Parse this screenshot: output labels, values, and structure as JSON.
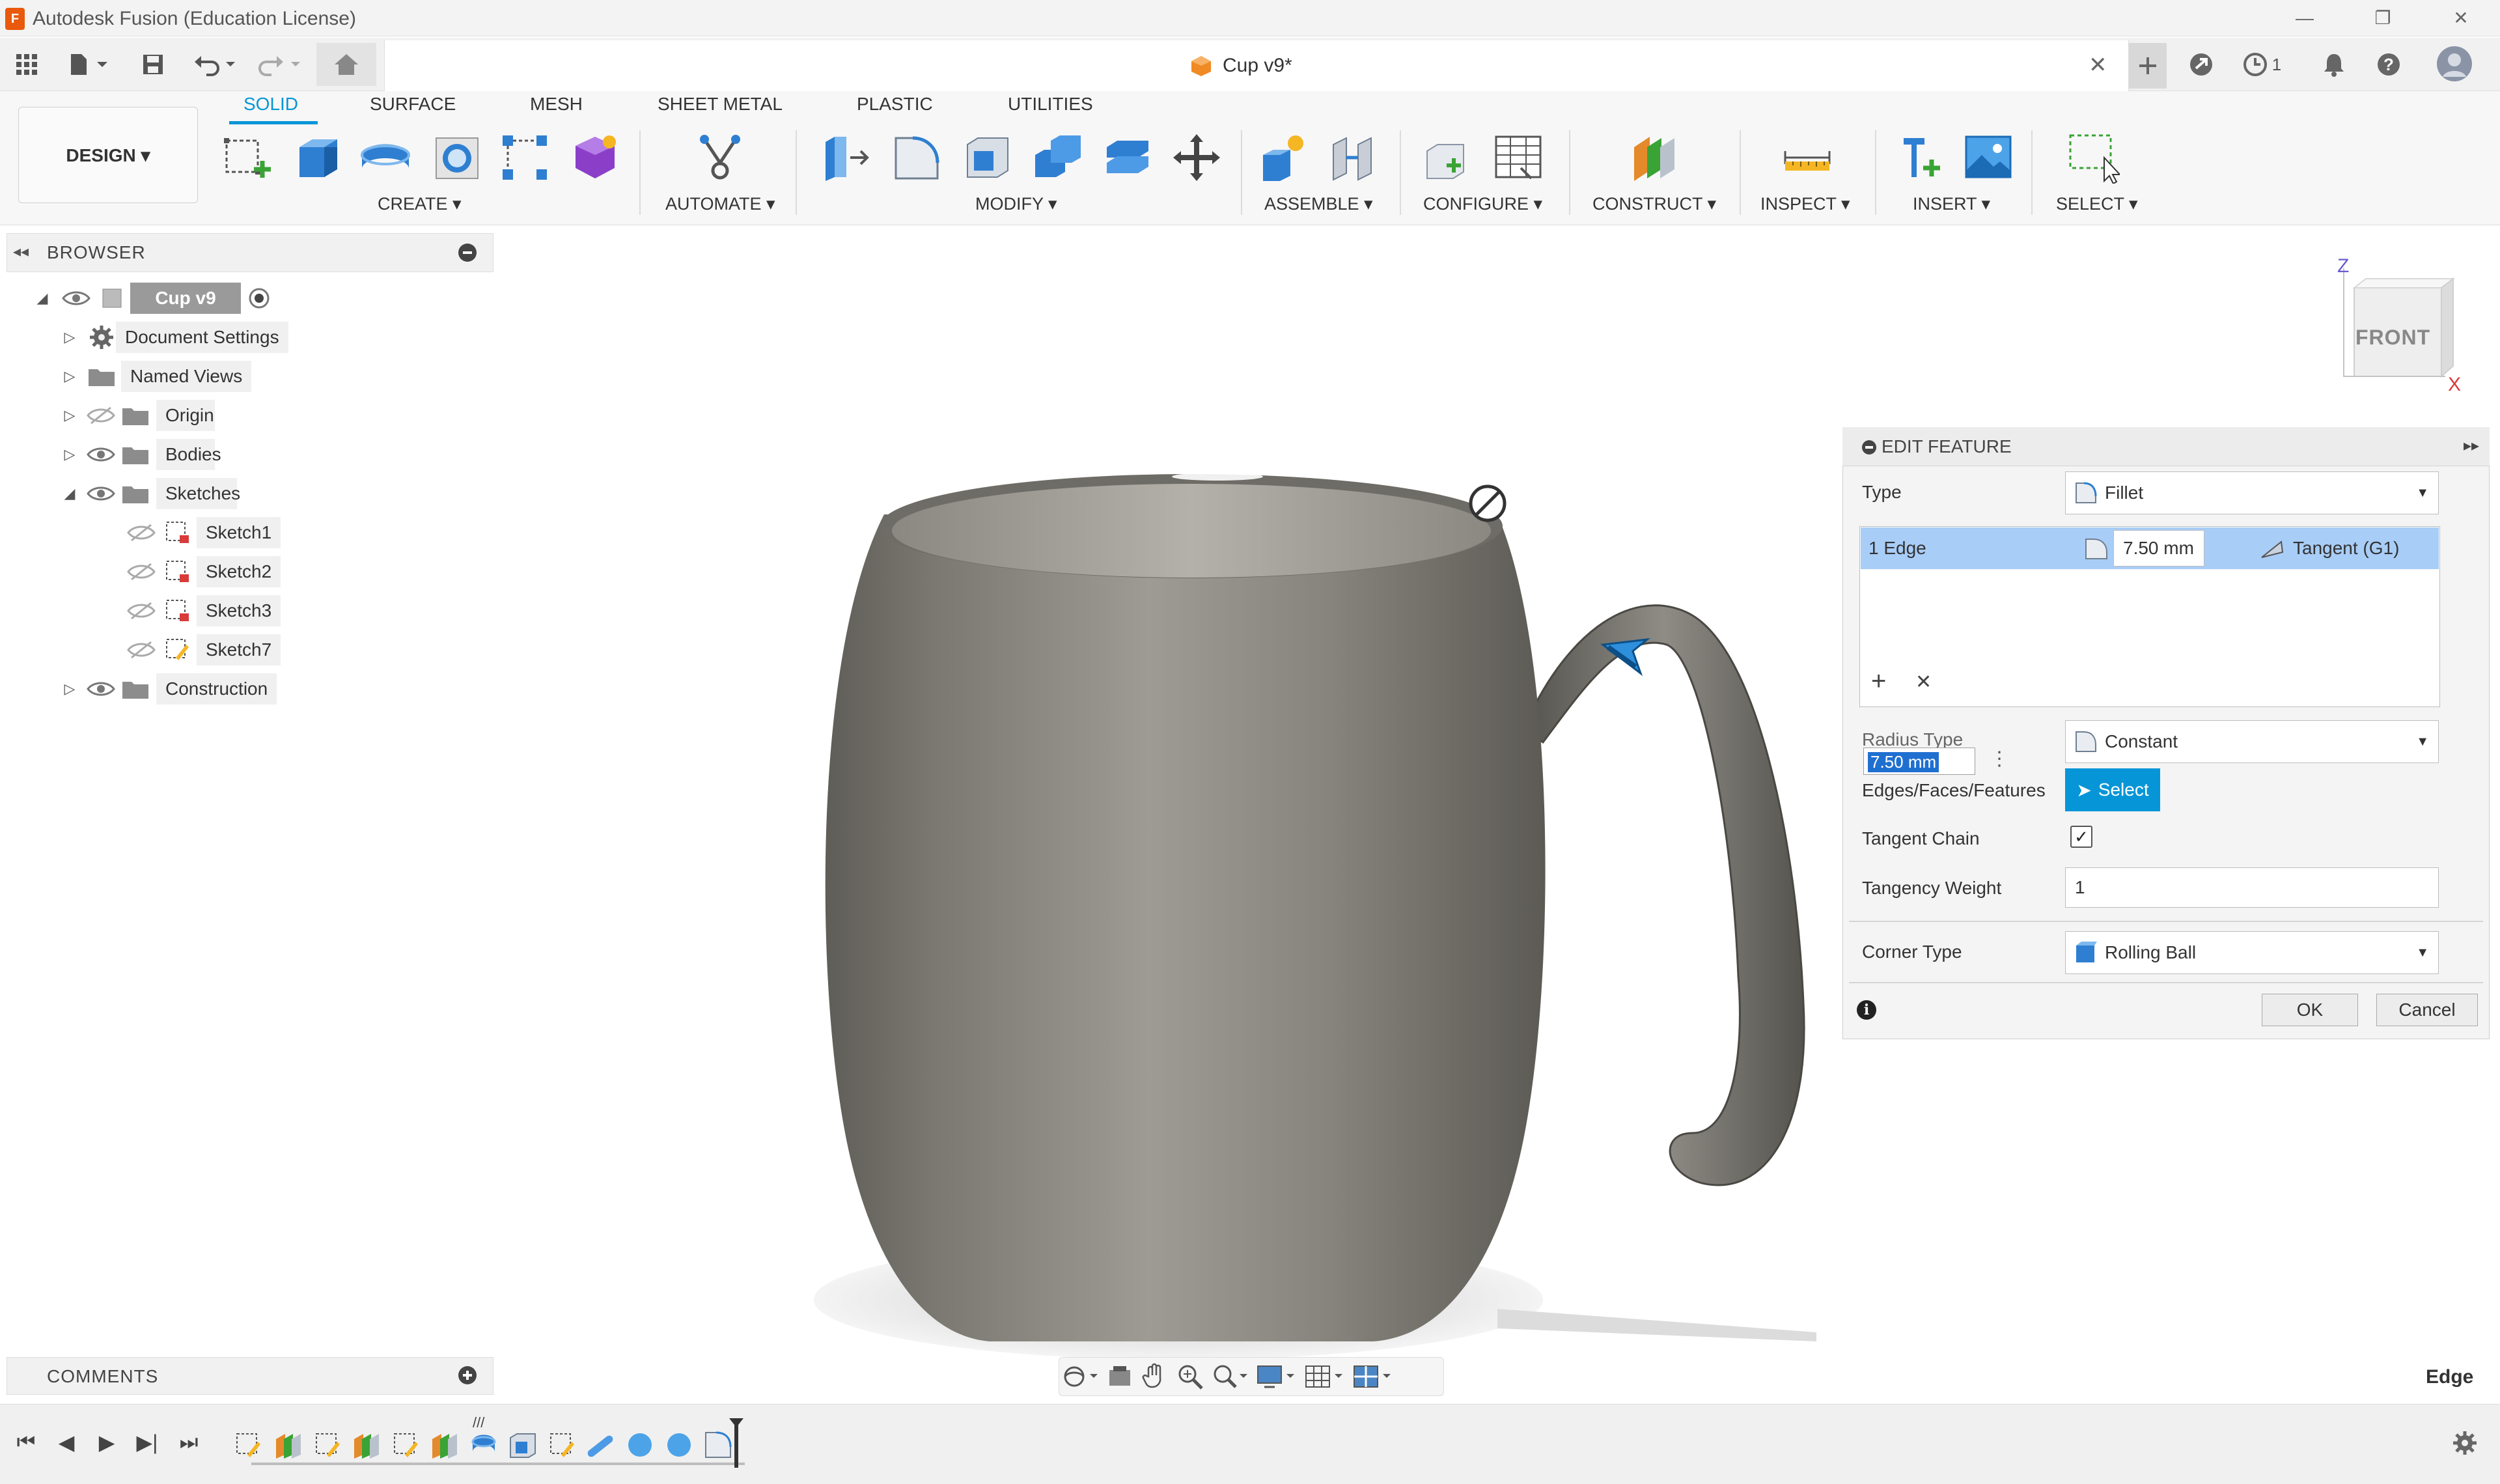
{
  "window": {
    "title": "Autodesk Fusion (Education License)",
    "logo_letter": "F",
    "minimize": "—",
    "restore": "❐",
    "close": "✕"
  },
  "doc_tab": {
    "label": "Cup v9*",
    "close": "✕",
    "notifications_count": "1"
  },
  "ribbon": {
    "workspace": "DESIGN ▾",
    "tabs": [
      "SOLID",
      "SURFACE",
      "MESH",
      "SHEET METAL",
      "PLASTIC",
      "UTILITIES"
    ],
    "active_tab": "SOLID",
    "groups": {
      "create": "CREATE ▾",
      "automate": "AUTOMATE ▾",
      "modify": "MODIFY ▾",
      "assemble": "ASSEMBLE ▾",
      "configure": "CONFIGURE ▾",
      "construct": "CONSTRUCT ▾",
      "inspect": "INSPECT ▾",
      "insert": "INSERT ▾",
      "select": "SELECT ▾"
    }
  },
  "browser": {
    "title": "BROWSER",
    "root": "Cup v9",
    "items": [
      {
        "label": "Document Settings"
      },
      {
        "label": "Named Views"
      },
      {
        "label": "Origin"
      },
      {
        "label": "Bodies"
      },
      {
        "label": "Sketches"
      },
      {
        "label": "Sketch1"
      },
      {
        "label": "Sketch2"
      },
      {
        "label": "Sketch3"
      },
      {
        "label": "Sketch7"
      },
      {
        "label": "Construction"
      }
    ]
  },
  "viewcube": {
    "face": "FRONT",
    "axis_z": "Z",
    "axis_x": "X"
  },
  "edit_feature": {
    "title": "EDIT FEATURE",
    "type_label": "Type",
    "type_value": "Fillet",
    "edge_label": "1 Edge",
    "edge_radius": "7.50 mm",
    "edge_continuity": "Tangent (G1)",
    "add": "+",
    "remove": "✕",
    "radius_type_label": "Radius Type",
    "radius_type_value": "Constant",
    "inline_input": "7.50 mm",
    "edges_label": "Edges/Faces/Features",
    "select_button": "Select",
    "tangent_chain_label": "Tangent Chain",
    "tangent_chain_checked": "✓",
    "tangency_weight_label": "Tangency Weight",
    "tangency_weight_value": "1",
    "corner_type_label": "Corner Type",
    "corner_type_value": "Rolling Ball",
    "ok": "OK",
    "cancel": "Cancel"
  },
  "comments": {
    "title": "COMMENTS"
  },
  "status": {
    "selection": "Edge"
  },
  "colors": {
    "accent": "#0696d7",
    "edge_row": "#a8cdf7",
    "model": "#7f7d76"
  }
}
